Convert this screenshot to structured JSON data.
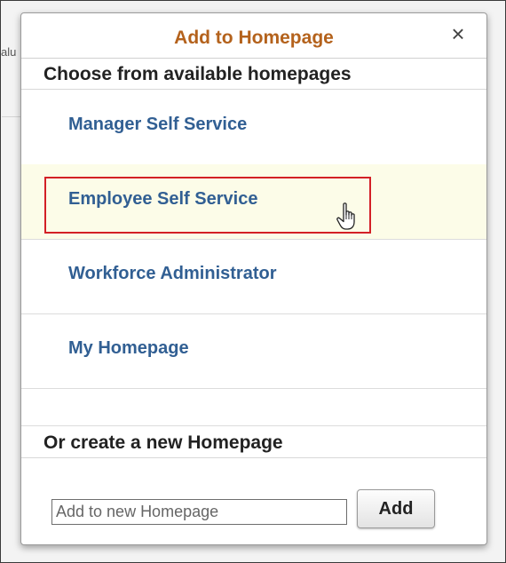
{
  "background": {
    "partial_text": "alu"
  },
  "dialog": {
    "title": "Add to Homepage",
    "close_glyph": "×",
    "close_icon": "close-icon",
    "available_section_title": "Choose from available homepages",
    "homepages": [
      {
        "label": "Manager Self Service"
      },
      {
        "label": "Employee Self Service",
        "hovered": true,
        "cursor": "hand-pointer-icon"
      },
      {
        "label": "Workforce Administrator"
      },
      {
        "label": "My Homepage"
      }
    ],
    "create_section_title": "Or create a new Homepage",
    "new_homepage_input": {
      "value": "",
      "placeholder": "Add to new Homepage"
    },
    "add_button_label": "Add"
  },
  "colors": {
    "title": "#b4621c",
    "link": "#315f93",
    "hover_row": "#fcfce8",
    "highlight_border": "#d32026"
  }
}
